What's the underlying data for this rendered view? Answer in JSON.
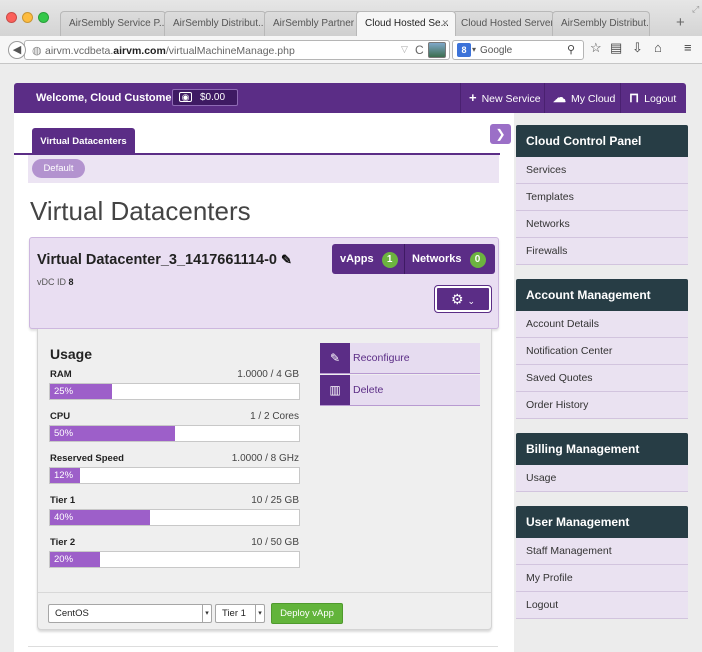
{
  "browser": {
    "tabs": [
      {
        "label": "AirSembly Service P...",
        "active": false
      },
      {
        "label": "AirSembly Distribut...",
        "active": false
      },
      {
        "label": "AirSembly Partner P...",
        "active": false
      },
      {
        "label": "Cloud Hosted Se...",
        "active": true
      },
      {
        "label": "Cloud Hosted Servers",
        "active": false
      },
      {
        "label": "AirSembly Distribut...",
        "active": false
      }
    ],
    "new_tab": "+",
    "url_prefix": "airvm.vcdbeta.",
    "url_domain": "airvm.com",
    "url_path": "/virtualMachineManage.php",
    "search_placeholder": "Google",
    "search_engine_letter": "8"
  },
  "header": {
    "welcome": "Welcome, Cloud Customer",
    "balance": "$0.00",
    "nav": [
      {
        "label": "New Service",
        "icon": "plus-icon"
      },
      {
        "label": "My Cloud",
        "icon": "cloud-icon"
      },
      {
        "label": "Logout",
        "icon": "unlock-icon"
      }
    ]
  },
  "main": {
    "tab": "Virtual Datacenters",
    "pill": "Default",
    "title": "Virtual Datacenters",
    "vdc": {
      "name": "Virtual Datacenter_3_1417661114-0",
      "id_label": "vDC ID",
      "id_value": "8",
      "vapps_label": "vApps",
      "vapps_count": "1",
      "networks_label": "Networks",
      "networks_count": "0"
    },
    "usage": {
      "title": "Usage",
      "resources": [
        {
          "label": "RAM",
          "value": "1.0000 / 4 GB",
          "percent_text": "25%",
          "percent": 25
        },
        {
          "label": "CPU",
          "value": "1 / 2 Cores",
          "percent_text": "50%",
          "percent": 50
        },
        {
          "label": "Reserved Speed",
          "value": "1.0000 / 8 GHz",
          "percent_text": "12%",
          "percent": 12
        },
        {
          "label": "Tier 1",
          "value": "10 / 25 GB",
          "percent_text": "40%",
          "percent": 40
        },
        {
          "label": "Tier 2",
          "value": "10 / 50 GB",
          "percent_text": "20%",
          "percent": 20
        }
      ]
    },
    "actions": [
      {
        "label": "Reconfigure",
        "icon": "pencil-icon"
      },
      {
        "label": "Delete",
        "icon": "trash-icon"
      }
    ],
    "deploy": {
      "os_selected": "CentOS",
      "tier_selected": "Tier 1",
      "button": "Deploy vApp"
    }
  },
  "sidebar": {
    "sections": [
      {
        "title": "Cloud Control Panel",
        "items": [
          "Services",
          "Templates",
          "Networks",
          "Firewalls"
        ]
      },
      {
        "title": "Account Management",
        "items": [
          "Account Details",
          "Notification Center",
          "Saved Quotes",
          "Order History"
        ]
      },
      {
        "title": "Billing Management",
        "items": [
          "Usage"
        ]
      },
      {
        "title": "User Management",
        "items": [
          "Staff Management",
          "My Profile",
          "Logout"
        ]
      }
    ]
  },
  "colors": {
    "brand_purple": "#5b2d86",
    "bar_fill": "#9d5fc9",
    "sidebar_head": "#273d45",
    "badge_green": "#6cb33f",
    "deploy_green": "#62b43b"
  }
}
